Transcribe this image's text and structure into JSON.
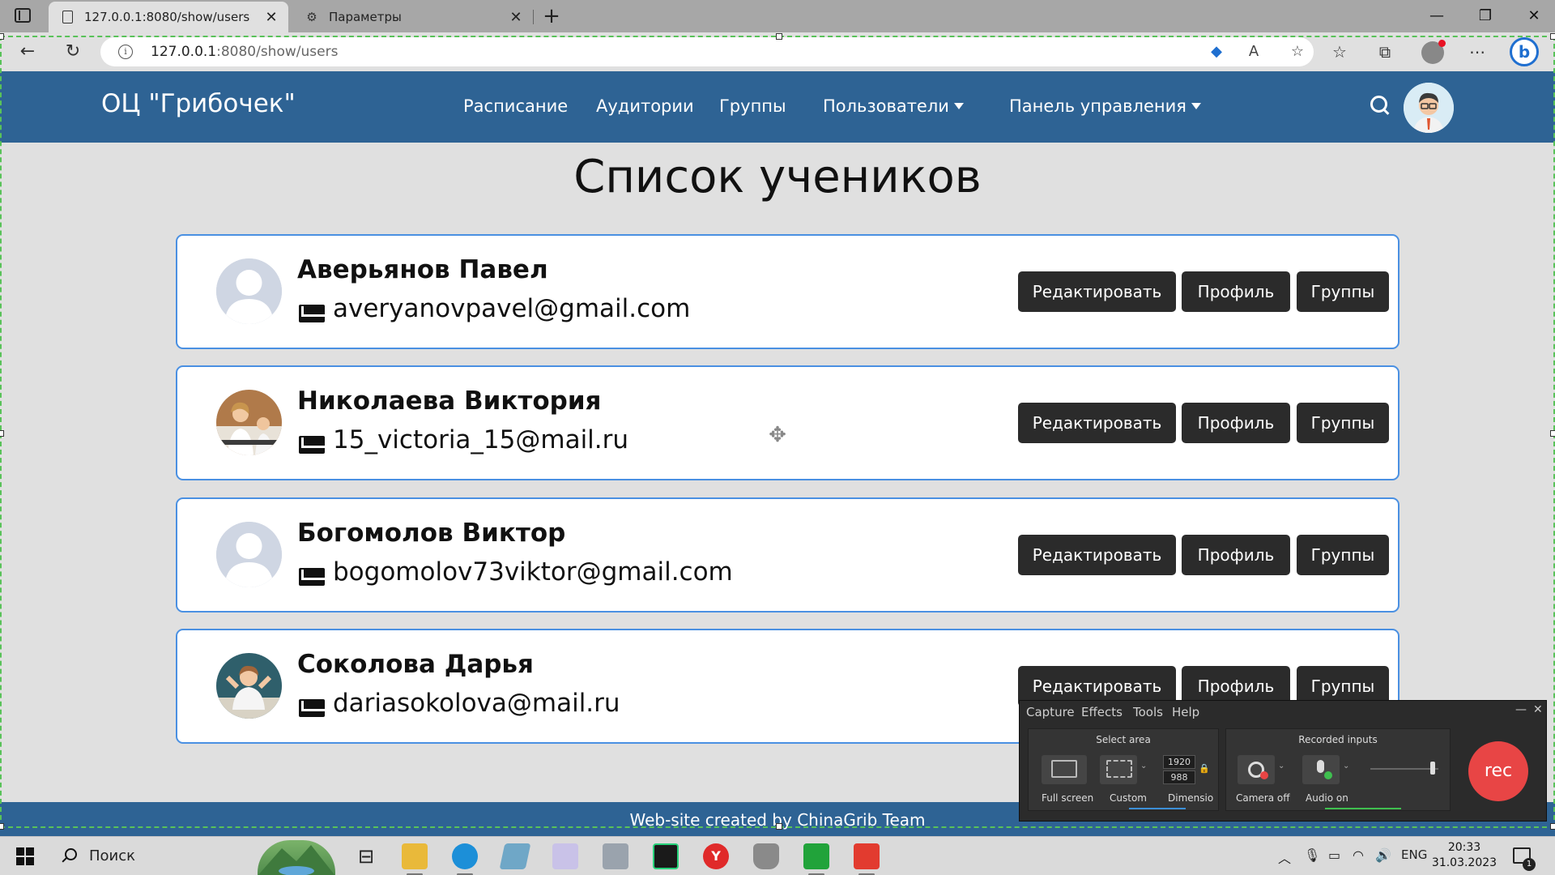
{
  "browser": {
    "tabs": [
      {
        "label": "127.0.0.1:8080/show/users",
        "icon": "page-icon"
      },
      {
        "label": "Параметры",
        "icon": "gear-icon"
      }
    ],
    "url_host": "127.0.0.1",
    "url_rest": ":8080/show/users"
  },
  "site": {
    "brand": "ОЦ \"Грибочек\"",
    "nav": {
      "schedule": "Расписание",
      "rooms": "Аудитории",
      "groups": "Группы",
      "users": "Пользователи",
      "control_panel": "Панель управления"
    },
    "page_title": "Список учеников",
    "students": [
      {
        "name": "Аверьянов Павел",
        "email": "averyanovpavel@gmail.com",
        "avatar": "placeholder"
      },
      {
        "name": "Николаева Виктория",
        "email": "15_victoria_15@mail.ru",
        "avatar": "photo"
      },
      {
        "name": "Богомолов Виктор",
        "email": "bogomolov73viktor@gmail.com",
        "avatar": "placeholder"
      },
      {
        "name": "Соколова Дарья",
        "email": "dariasokolova@mail.ru",
        "avatar": "photo"
      }
    ],
    "buttons": {
      "edit": "Редактировать",
      "profile": "Профиль",
      "groups": "Группы"
    },
    "footer": "Web-site created by ChinaGrib Team",
    "colors": {
      "header": "#2e6394",
      "card_border": "#4a90e2",
      "button": "#2b2b2b"
    }
  },
  "recorder": {
    "menu": [
      "Capture",
      "Effects",
      "Tools",
      "Help"
    ],
    "select_area_title": "Select area",
    "recorded_inputs_title": "Recorded inputs",
    "options": {
      "full_screen": "Full screen",
      "custom": "Custom",
      "dimensions": "Dimensio",
      "camera": "Camera off",
      "audio": "Audio on"
    },
    "width": "1920",
    "height": "988",
    "rec_label": "rec"
  },
  "taskbar": {
    "search_label": "Поиск",
    "language": "ENG",
    "time": "20:33",
    "date": "31.03.2023",
    "notification_count": "1"
  }
}
